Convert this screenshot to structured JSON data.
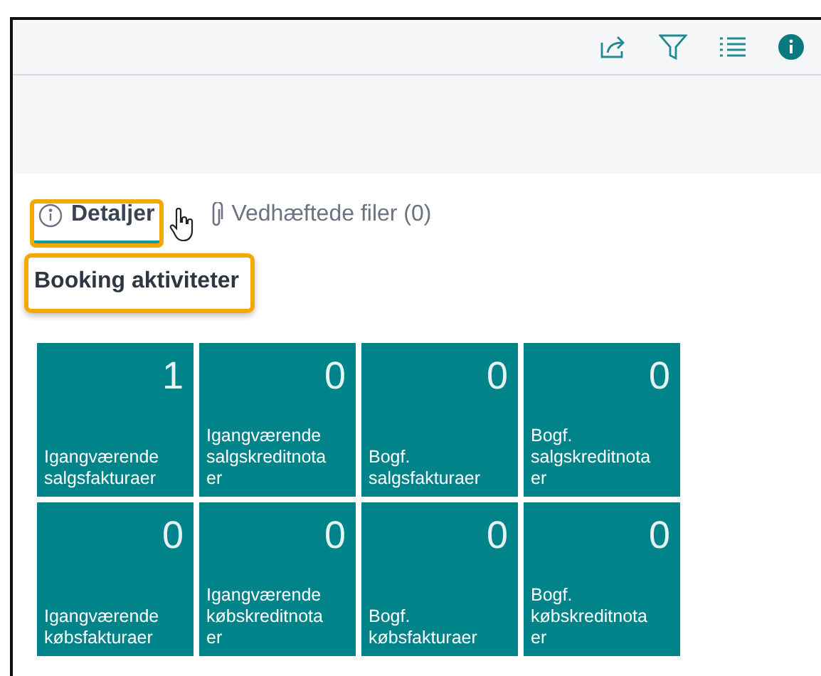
{
  "tabs": [
    {
      "label": "Detaljer",
      "selected": true,
      "highlighted": true
    },
    {
      "label": "Vedhæftede filer (0)",
      "selected": false,
      "highlighted": false
    }
  ],
  "section": {
    "title": "Booking aktiviteter",
    "highlighted": true
  },
  "tile_rows": [
    {
      "tiles": [
        {
          "count": "1",
          "caption": "Igangværende salgsfakturaer"
        },
        {
          "count": "0",
          "caption": "Igangværende salgskreditnotaer"
        },
        {
          "count": "0",
          "caption": "Bogf. salgsfakturaer"
        },
        {
          "count": "0",
          "caption": "Bogf. salgskreditnotaer"
        }
      ]
    },
    {
      "tiles": [
        {
          "count": "0",
          "caption": "Igangværende købsfakturaer"
        },
        {
          "count": "0",
          "caption": "Igangværende købskreditnotaer"
        },
        {
          "count": "0",
          "caption": "Bogf. købsfakturaer"
        },
        {
          "count": "0",
          "caption": "Bogf. købskreditnotaer"
        }
      ]
    }
  ]
}
